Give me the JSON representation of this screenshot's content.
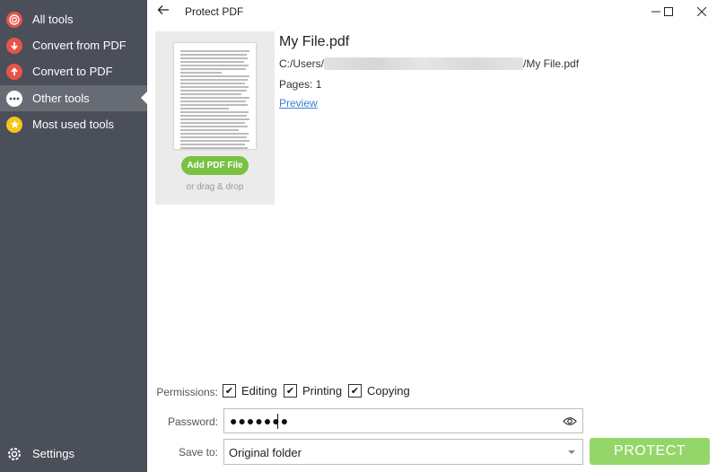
{
  "window": {
    "title": "Protect PDF"
  },
  "sidebar": {
    "items": [
      {
        "label": "All tools",
        "icon": "target-icon",
        "color": "#e8534a"
      },
      {
        "label": "Convert from PDF",
        "icon": "arrow-down-icon",
        "color": "#e8534a"
      },
      {
        "label": "Convert to PDF",
        "icon": "arrow-up-icon",
        "color": "#e8534a"
      },
      {
        "label": "Other tools",
        "icon": "more-dots-icon",
        "color": "#4a4f59",
        "active": true
      },
      {
        "label": "Most used tools",
        "icon": "star-icon",
        "color": "#f5c518"
      }
    ],
    "settings_label": "Settings"
  },
  "file": {
    "name": "My File.pdf",
    "path_prefix": "C:/Users/",
    "path_suffix": "/My File.pdf",
    "pages": "Pages: 1",
    "preview_label": "Preview"
  },
  "card": {
    "add_label": "Add PDF File",
    "drag_label": "or drag & drop"
  },
  "form": {
    "permissions_label": "Permissions:",
    "permissions": [
      {
        "label": "Editing",
        "checked": true
      },
      {
        "label": "Printing",
        "checked": true
      },
      {
        "label": "Copying",
        "checked": true
      }
    ],
    "password_label": "Password:",
    "password_value": "●●●●●●●",
    "save_label": "Save to:",
    "save_value": "Original folder",
    "protect_label": "PROTECT"
  },
  "colors": {
    "accent": "#78c142",
    "protect": "#95d66a",
    "sidebar": "#4a4f59",
    "link": "#3b7dd8"
  }
}
